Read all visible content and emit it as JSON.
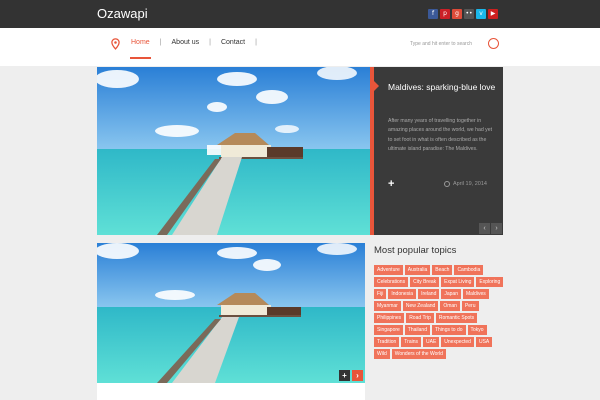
{
  "header": {
    "logo": "Ozawapi",
    "social": [
      {
        "icon": "facebook-icon",
        "glyph": "f",
        "color": "#3b5998"
      },
      {
        "icon": "pinterest-icon",
        "glyph": "p",
        "color": "#cb2027"
      },
      {
        "icon": "google-plus-icon",
        "glyph": "g",
        "color": "#dd4b39"
      },
      {
        "icon": "flickr-icon",
        "glyph": "••",
        "color": "#555555"
      },
      {
        "icon": "vimeo-icon",
        "glyph": "v",
        "color": "#1ab7ea"
      },
      {
        "icon": "youtube-icon",
        "glyph": "▶",
        "color": "#cd201f"
      }
    ]
  },
  "nav": {
    "items": [
      "Home",
      "About us",
      "Contact"
    ],
    "search_placeholder": "Type and hit enter to search"
  },
  "hero": {
    "title": "Maldives: sparking-blue love",
    "excerpt": "After many years of travelling together in amazing places around the world, we had yet to set foot in what is often described as the ultimate island paradise: The Maldives.",
    "date": "April 19, 2014",
    "plus": "+",
    "prev": "‹",
    "next": "›"
  },
  "post": {
    "add": "+",
    "next": "›"
  },
  "sidebar": {
    "title": "Most popular topics",
    "tags": [
      "Adventure",
      "Australia",
      "Beach",
      "Cambodia",
      "Celebrations",
      "City Break",
      "Expat Living",
      "Exploring",
      "Fiji",
      "Indonesia",
      "Ireland",
      "Japan",
      "Maldives",
      "Myanmar",
      "New Zealand",
      "Oman",
      "Peru",
      "Philippines",
      "Road Trip",
      "Romantic Spots",
      "Singapore",
      "Thailand",
      "Things to do",
      "Tokyo",
      "Tradition",
      "Trains",
      "UAE",
      "Unexpected",
      "USA",
      "Wild",
      "Wonders of the World"
    ]
  },
  "colors": {
    "accent": "#e8553a",
    "tag": "#f0735a",
    "dark": "#333333"
  }
}
